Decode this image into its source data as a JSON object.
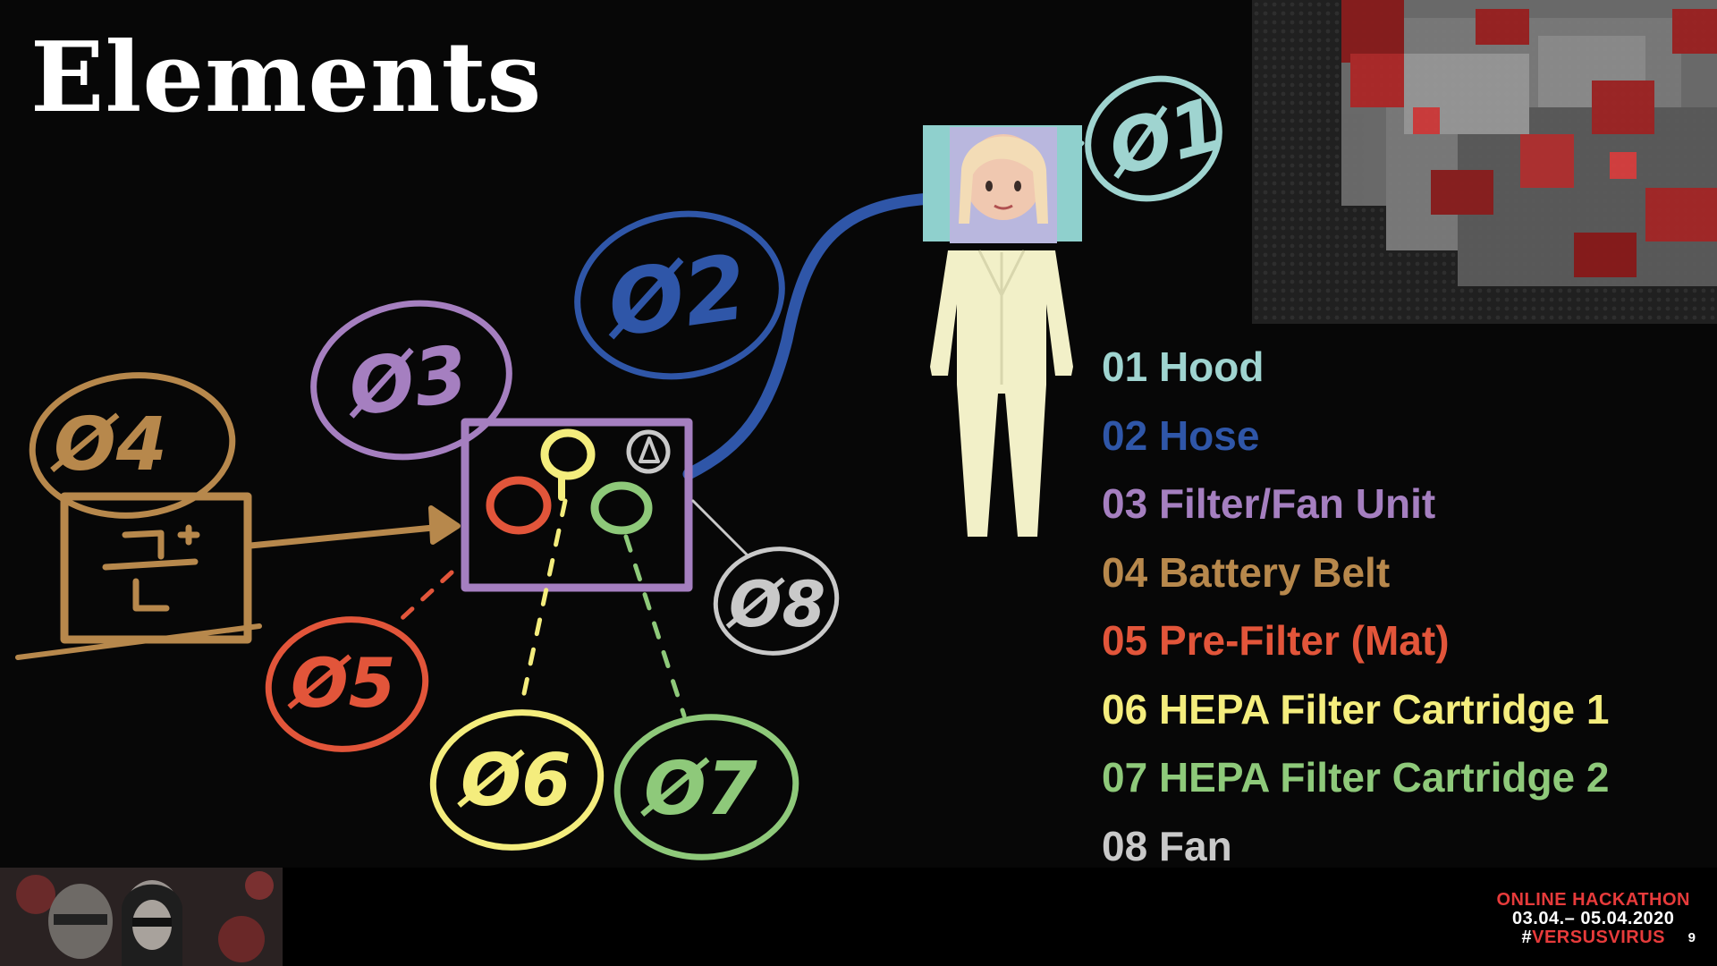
{
  "slide": {
    "title": "Elements",
    "page_number": "9"
  },
  "colors": {
    "background": "#070707",
    "hood": "#9fd4d0",
    "hose": "#2f56a8",
    "filter_fan_unit": "#a57fc0",
    "battery_belt": "#b7884c",
    "pre_filter": "#e2553a",
    "hepa_1": "#f4ed7d",
    "hepa_2": "#8ec97a",
    "fan": "#c9c9c9",
    "hackathon_red": "#e73b3b"
  },
  "legend": [
    {
      "label": "01 Hood",
      "color": "#9fd4d0"
    },
    {
      "label": "02 Hose",
      "color": "#2f56a8"
    },
    {
      "label": "03 Filter/Fan Unit",
      "color": "#a57fc0"
    },
    {
      "label": "04 Battery Belt",
      "color": "#b7884c"
    },
    {
      "label": "05 Pre-Filter (Mat)",
      "color": "#e2553a"
    },
    {
      "label": "06 HEPA Filter Cartridge 1",
      "color": "#f4ed7d"
    },
    {
      "label": "07 HEPA Filter Cartridge 2",
      "color": "#8ec97a"
    },
    {
      "label": "08 Fan",
      "color": "#c9c9c9"
    }
  ],
  "sketch_labels": {
    "hood": "Ø1",
    "hose": "Ø2",
    "filter_fan_unit": "Ø3",
    "battery_belt": "Ø4",
    "pre_filter": "Ø5",
    "hepa_1": "Ø6",
    "hepa_2": "Ø7",
    "fan": "Ø8"
  },
  "branding": {
    "line1": "ONLINE HACKATHON",
    "line2": "03.04.– 05.04.2020",
    "hash": "#",
    "tag": "VERSUSVIRUS"
  },
  "icons": {
    "person": "person-in-protective-suit-icon",
    "battery": "battery-plus-minus-icon",
    "virus": "coronavirus-image"
  }
}
